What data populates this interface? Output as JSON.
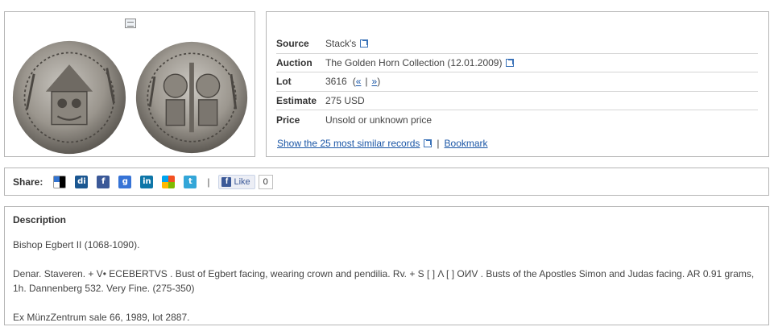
{
  "record": {
    "source_label": "Source",
    "source_value": "Stack's",
    "auction_label": "Auction",
    "auction_value": "The Golden Horn Collection (12.01.2009)",
    "lot_label": "Lot",
    "lot_value": "3616",
    "lot_prev": "«",
    "lot_next": "»",
    "estimate_label": "Estimate",
    "estimate_value": "275 USD",
    "price_label": "Price",
    "price_value": "Unsold or unknown price"
  },
  "actions": {
    "similar_link": "Show the 25 most similar records",
    "bookmark_link": "Bookmark",
    "separator": "|"
  },
  "share": {
    "label": "Share:",
    "like_label": "Like",
    "like_count": "0",
    "icons": [
      "delicious-icon",
      "digg-icon",
      "facebook-icon",
      "google-icon",
      "linkedin-icon",
      "windows-live-icon",
      "twitter-icon"
    ]
  },
  "description": {
    "title": "Description",
    "paragraphs": [
      "Bishop Egbert II (1068-1090).",
      "Denar. Staveren. + V• ECEBERTVS . Bust of Egbert facing, wearing crown and pendilia. Rv. + S [ ] Λ [ ] OИV . Busts of the Apostles Simon and Judas facing. AR 0.91 grams, 1h. Dannenberg 532. Very Fine. (275-350)",
      "Ex MünzZentrum sale 66, 1989, lot 2887."
    ]
  },
  "colors": {
    "link": "#1a56a6",
    "border": "#b5b5b5",
    "facebook": "#3b5998",
    "twitter": "#33a6d8",
    "linkedin": "#0e76a8",
    "google": "#3673d6"
  }
}
